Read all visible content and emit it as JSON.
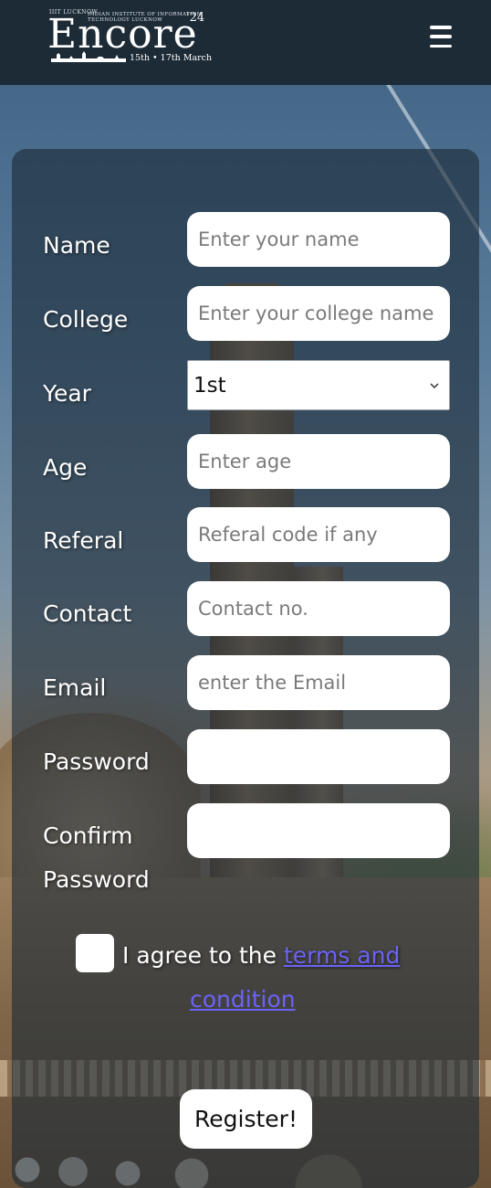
{
  "header": {
    "logo_top_text": "IIIT LUCKNOW",
    "logo_sub_text": "INDIAN INSTITUTE OF INFORMATION TECHNOLOGY LUCKNOW",
    "logo_word": "Encore",
    "logo_year": "'24",
    "logo_dates": "15th • 17th March",
    "menu_icon": "hamburger-icon"
  },
  "form": {
    "fields": [
      {
        "label": "Name",
        "placeholder": "Enter your name"
      },
      {
        "label": "College",
        "placeholder": "Enter your college name"
      },
      {
        "label": "Year",
        "value": "1st"
      },
      {
        "label": "Age",
        "placeholder": "Enter age"
      },
      {
        "label": "Referal",
        "placeholder": "Referal code if any"
      },
      {
        "label": "Contact",
        "placeholder": "Contact no."
      },
      {
        "label": "Email",
        "placeholder": "enter the Email"
      },
      {
        "label": "Password",
        "placeholder": ""
      },
      {
        "label_line1": "Confirm",
        "label_line2": "Password",
        "placeholder": ""
      }
    ],
    "agree_text": "I agree to the ",
    "terms_line1": "terms and",
    "terms_line2": "condition",
    "register_label": "Register!"
  },
  "colors": {
    "header_bg": "#1d2b36",
    "card_bg": "rgba(28,42,55,0.62)",
    "link": "#6b63f5",
    "field_bg": "#ffffff"
  }
}
